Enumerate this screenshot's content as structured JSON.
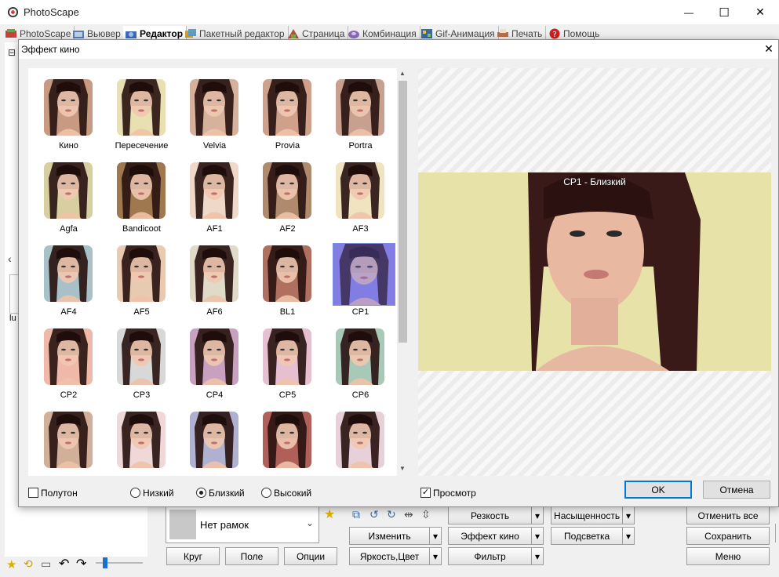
{
  "window": {
    "title": "PhotoScape",
    "minimize_glyph": "—",
    "maximize_glyph": "☐",
    "close_glyph": "✕"
  },
  "tabs": [
    {
      "label": "PhotoScape",
      "icon": "photoscape-icon",
      "active": false
    },
    {
      "label": "Вьювер",
      "icon": "viewer-icon",
      "active": false
    },
    {
      "label": "Редактор",
      "icon": "editor-icon",
      "active": true
    },
    {
      "label": "Пакетный редактор",
      "icon": "batch-editor-icon",
      "active": false
    },
    {
      "label": "Страница",
      "icon": "page-icon",
      "active": false
    },
    {
      "label": "Комбинация",
      "icon": "combine-icon",
      "active": false
    },
    {
      "label": "Gif-Анимация",
      "icon": "gif-icon",
      "active": false
    },
    {
      "label": "Печать",
      "icon": "print-icon",
      "active": false
    },
    {
      "label": "Помощь",
      "icon": "help-icon",
      "active": false
    }
  ],
  "left_panel": {
    "partial_label": "lu",
    "collapse_glyph": "⊟",
    "scroll_glyph": "‹"
  },
  "dialog": {
    "title": "Эффект кино",
    "close_glyph": "✕",
    "effects": [
      {
        "label": "Кино",
        "tint": "#c89a82"
      },
      {
        "label": "Пересечение",
        "tint": "#e8e0b0"
      },
      {
        "label": "Velvia",
        "tint": "#d6b29c"
      },
      {
        "label": "Provia",
        "tint": "#cfa08a"
      },
      {
        "label": "Portra",
        "tint": "#c8a090"
      },
      {
        "label": "Agfa",
        "tint": "#d8cfa0"
      },
      {
        "label": "Bandicoot",
        "tint": "#a07850"
      },
      {
        "label": "AF1",
        "tint": "#f0d8c8"
      },
      {
        "label": "AF2",
        "tint": "#b08a6c"
      },
      {
        "label": "AF3",
        "tint": "#efe3c0"
      },
      {
        "label": "AF4",
        "tint": "#a8c0c8"
      },
      {
        "label": "AF5",
        "tint": "#e8cab0"
      },
      {
        "label": "AF6",
        "tint": "#e0dac8"
      },
      {
        "label": "BL1",
        "tint": "#b07060"
      },
      {
        "label": "CP1",
        "tint": "#8e88e0"
      },
      {
        "label": "CP2",
        "tint": "#f0b8a8"
      },
      {
        "label": "CP3",
        "tint": "#d8d8d8"
      },
      {
        "label": "CP4",
        "tint": "#c8a0c0"
      },
      {
        "label": "CP5",
        "tint": "#e6c0d0"
      },
      {
        "label": "CP6",
        "tint": "#a8c8b8"
      },
      {
        "label": "",
        "tint": "#d0b098"
      },
      {
        "label": "",
        "tint": "#f0d8d8"
      },
      {
        "label": "",
        "tint": "#b0b0d0"
      },
      {
        "label": "",
        "tint": "#b06058"
      },
      {
        "label": "",
        "tint": "#e8d0d8"
      }
    ],
    "selected_index": 14,
    "scroll_up_glyph": "▲",
    "scroll_down_glyph": "▼",
    "preview_caption": "CP1 - Близкий",
    "preview_background": "#e6e2a8",
    "halftone": {
      "label": "Полутон",
      "checked": false
    },
    "levels": [
      {
        "label": "Низкий",
        "checked": false
      },
      {
        "label": "Близкий",
        "checked": true
      },
      {
        "label": "Высокий",
        "checked": false
      }
    ],
    "preview_check": {
      "label": "Просмотр",
      "checked": true
    },
    "ok_label": "OK",
    "cancel_label": "Отмена"
  },
  "bottom": {
    "frame_value": "Нет рамок",
    "frame_buttons": [
      "Круг",
      "Поле",
      "Опции"
    ],
    "menu_buttons": [
      {
        "label": "Резкость"
      },
      {
        "label": "Насыщенность"
      },
      {
        "label": "Изменить"
      },
      {
        "label": "Эффект кино"
      },
      {
        "label": "Подсветка"
      },
      {
        "label": "Яркость,Цвет"
      },
      {
        "label": "Фильтр"
      }
    ],
    "right_buttons": [
      "Отменить все",
      "Сохранить",
      "Меню"
    ]
  }
}
